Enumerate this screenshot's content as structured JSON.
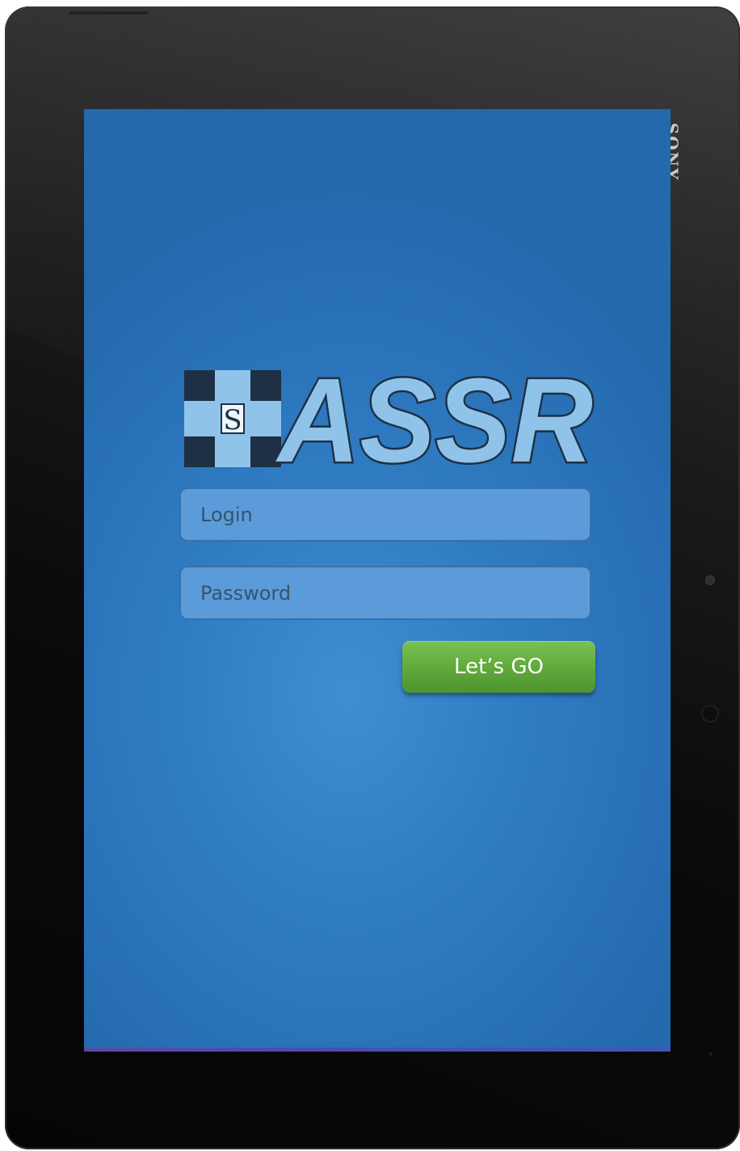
{
  "device": {
    "brand": "SONY"
  },
  "app": {
    "logo_text": "ASSR",
    "logo_badge_letter": "S",
    "colors": {
      "background": "#2f7bc2",
      "field_fill": "#5c9bd9",
      "button": "#5fa83b",
      "logo_light": "#8fc3ea",
      "logo_dark": "#1e3044"
    }
  },
  "login_form": {
    "login_placeholder": "Login",
    "password_placeholder": "Password",
    "submit_label": "Let’s GO"
  }
}
